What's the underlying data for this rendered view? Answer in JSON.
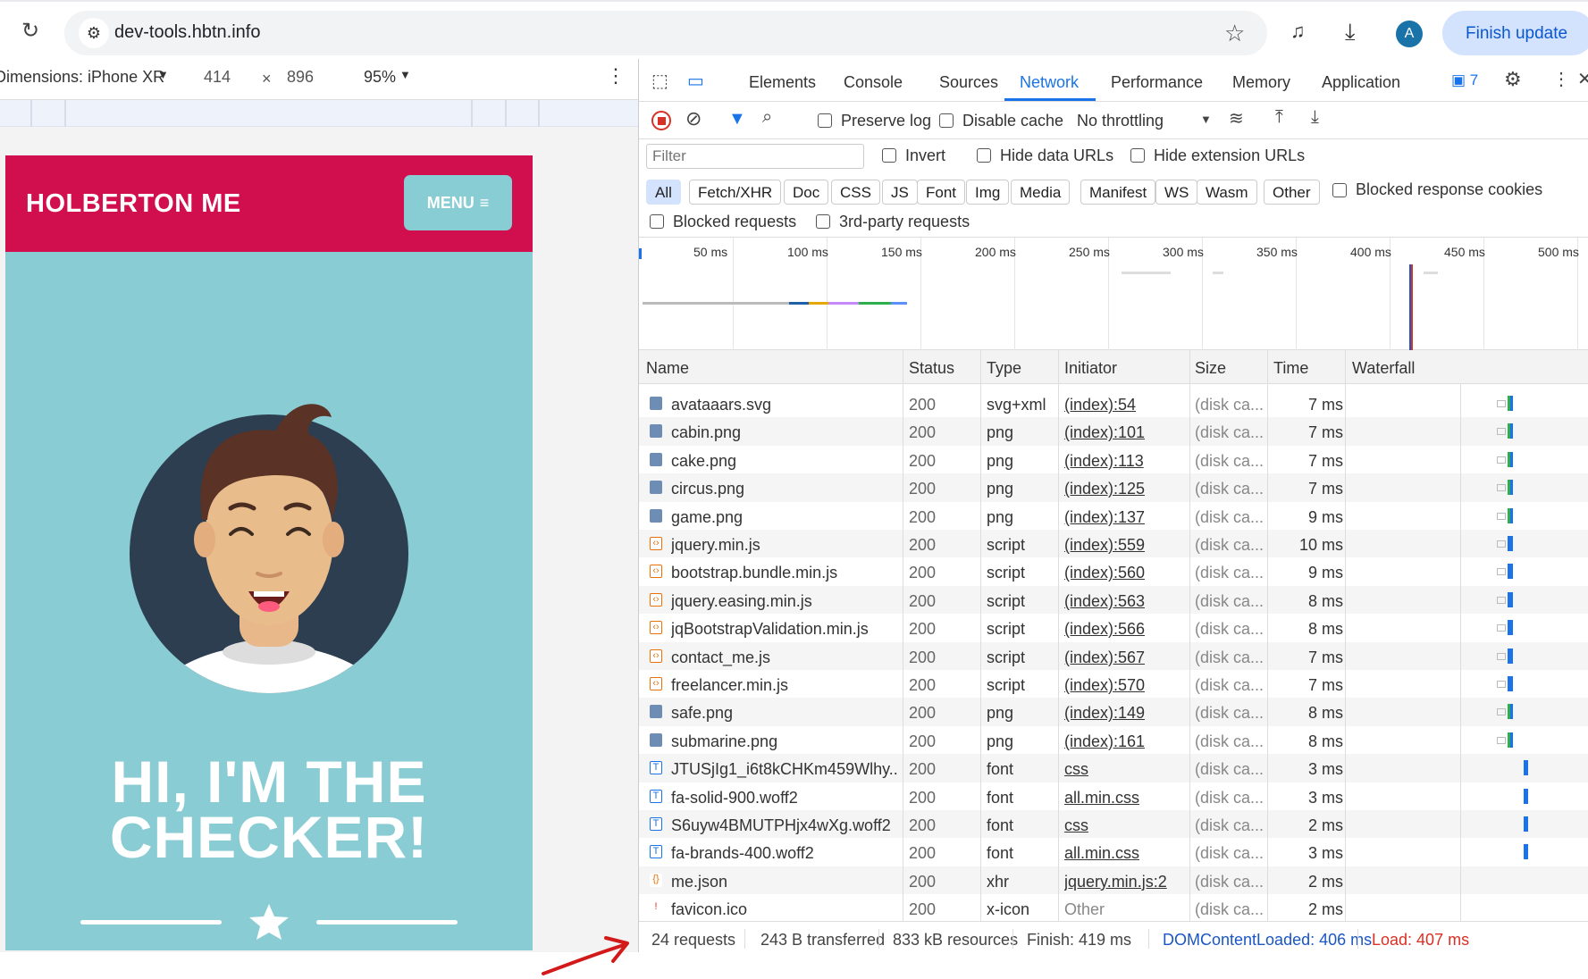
{
  "browser": {
    "url": "dev-tools.hbtn.info",
    "profile_initial": "A",
    "finish_update_label": "Finish update"
  },
  "device_toolbar": {
    "dimensions_label": "Dimensions: iPhone XR",
    "width": "414",
    "times": "×",
    "height": "896",
    "zoom": "95%"
  },
  "page": {
    "brand": "HOLBERTON ME",
    "menu_label": "MENU",
    "hero_line1": "HI, I'M THE",
    "hero_line2": "CHECKER!"
  },
  "devtools": {
    "tabs": [
      "Elements",
      "Console",
      "Sources",
      "Network",
      "Performance",
      "Memory",
      "Application"
    ],
    "active_tab": "Network",
    "issues_count": "7",
    "toolbar": {
      "preserve_log": "Preserve log",
      "disable_cache": "Disable cache",
      "throttling": "No throttling"
    },
    "filter": {
      "placeholder": "Filter",
      "invert": "Invert",
      "hide_data_urls": "Hide data URLs",
      "hide_extension_urls": "Hide extension URLs"
    },
    "type_filters": [
      "All",
      "Fetch/XHR",
      "Doc",
      "CSS",
      "JS",
      "Font",
      "Img",
      "Media",
      "Manifest",
      "WS",
      "Wasm",
      "Other"
    ],
    "blocked_response_cookies": "Blocked response cookies",
    "blocked_requests": "Blocked requests",
    "third_party_requests": "3rd-party requests",
    "overview_ticks": [
      "50 ms",
      "100 ms",
      "150 ms",
      "200 ms",
      "250 ms",
      "300 ms",
      "350 ms",
      "400 ms",
      "450 ms",
      "500 ms"
    ],
    "columns": [
      "Name",
      "Status",
      "Type",
      "Initiator",
      "Size",
      "Time",
      "Waterfall"
    ],
    "requests": [
      {
        "name": "avataaars.svg",
        "status": "200",
        "type": "svg+xml",
        "initiator": "(index):54",
        "size": "(disk ca...",
        "time": "7 ms",
        "icon": "image-icon"
      },
      {
        "name": "cabin.png",
        "status": "200",
        "type": "png",
        "initiator": "(index):101",
        "size": "(disk ca...",
        "time": "7 ms",
        "icon": "image-icon"
      },
      {
        "name": "cake.png",
        "status": "200",
        "type": "png",
        "initiator": "(index):113",
        "size": "(disk ca...",
        "time": "7 ms",
        "icon": "image-icon"
      },
      {
        "name": "circus.png",
        "status": "200",
        "type": "png",
        "initiator": "(index):125",
        "size": "(disk ca...",
        "time": "7 ms",
        "icon": "image-icon"
      },
      {
        "name": "game.png",
        "status": "200",
        "type": "png",
        "initiator": "(index):137",
        "size": "(disk ca...",
        "time": "9 ms",
        "icon": "image-icon"
      },
      {
        "name": "jquery.min.js",
        "status": "200",
        "type": "script",
        "initiator": "(index):559",
        "size": "(disk ca...",
        "time": "10 ms",
        "icon": "script-icon"
      },
      {
        "name": "bootstrap.bundle.min.js",
        "status": "200",
        "type": "script",
        "initiator": "(index):560",
        "size": "(disk ca...",
        "time": "9 ms",
        "icon": "script-icon"
      },
      {
        "name": "jquery.easing.min.js",
        "status": "200",
        "type": "script",
        "initiator": "(index):563",
        "size": "(disk ca...",
        "time": "8 ms",
        "icon": "script-icon"
      },
      {
        "name": "jqBootstrapValidation.min.js",
        "status": "200",
        "type": "script",
        "initiator": "(index):566",
        "size": "(disk ca...",
        "time": "8 ms",
        "icon": "script-icon"
      },
      {
        "name": "contact_me.js",
        "status": "200",
        "type": "script",
        "initiator": "(index):567",
        "size": "(disk ca...",
        "time": "7 ms",
        "icon": "script-icon"
      },
      {
        "name": "freelancer.min.js",
        "status": "200",
        "type": "script",
        "initiator": "(index):570",
        "size": "(disk ca...",
        "time": "7 ms",
        "icon": "script-icon"
      },
      {
        "name": "safe.png",
        "status": "200",
        "type": "png",
        "initiator": "(index):149",
        "size": "(disk ca...",
        "time": "8 ms",
        "icon": "image-icon"
      },
      {
        "name": "submarine.png",
        "status": "200",
        "type": "png",
        "initiator": "(index):161",
        "size": "(disk ca...",
        "time": "8 ms",
        "icon": "image-icon"
      },
      {
        "name": "JTUSjIg1_i6t8kCHKm459Wlhy...",
        "status": "200",
        "type": "font",
        "initiator": "css",
        "size": "(disk ca...",
        "time": "3 ms",
        "icon": "font-icon"
      },
      {
        "name": "fa-solid-900.woff2",
        "status": "200",
        "type": "font",
        "initiator": "all.min.css",
        "size": "(disk ca...",
        "time": "3 ms",
        "icon": "font-icon"
      },
      {
        "name": "S6uyw4BMUTPHjx4wXg.woff2",
        "status": "200",
        "type": "font",
        "initiator": "css",
        "size": "(disk ca...",
        "time": "2 ms",
        "icon": "font-icon"
      },
      {
        "name": "fa-brands-400.woff2",
        "status": "200",
        "type": "font",
        "initiator": "all.min.css",
        "size": "(disk ca...",
        "time": "3 ms",
        "icon": "font-icon"
      },
      {
        "name": "me.json",
        "status": "200",
        "type": "xhr",
        "initiator": "jquery.min.js:2",
        "size": "(disk ca...",
        "time": "2 ms",
        "icon": "json-icon"
      },
      {
        "name": "favicon.ico",
        "status": "200",
        "type": "x-icon",
        "initiator": "Other",
        "size": "(disk ca...",
        "time": "2 ms",
        "icon": "favicon-icon"
      }
    ],
    "summary": {
      "requests": "24 requests",
      "transferred": "243 B transferred",
      "resources": "833 kB resources",
      "finish": "Finish: 419 ms",
      "dom_content_loaded": "DOMContentLoaded: 406 ms",
      "load": "Load: 407 ms"
    }
  },
  "colors": {
    "brand_red": "#d10f4f",
    "teal": "#89ccd3",
    "devtools_blue": "#1a73e8",
    "dcl_blue": "#1a56c4",
    "load_red": "#d93025"
  }
}
